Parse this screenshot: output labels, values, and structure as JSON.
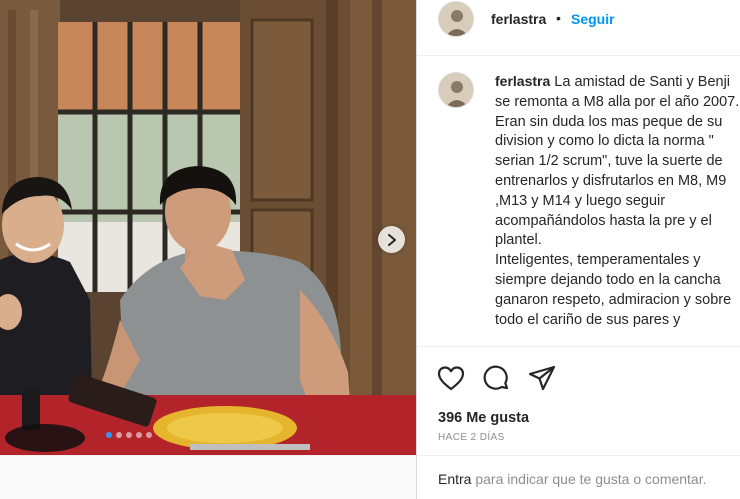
{
  "post": {
    "author": "ferlastra",
    "separator": "•",
    "follow_label": "Seguir",
    "caption": "La amistad de Santi y Benji\nse remonta a M8 alla por el año 2007.\nEran sin duda los mas peque de su\ndivision y como lo dicta la norma \"\nserian 1/2 scrum\", tuve la suerte de\nentrenarlos y disfrutarlos en M8, M9\n,M13 y M14 y luego seguir\nacompañándolos hasta la pre y el\nplantel.\nInteligentes, temperamentales y\nsiempre dejando todo en la cancha\nganaron respeto, admiracion y sobre\ntodo el cariño de sus pares y",
    "likes": "396 Me gusta",
    "time_ago": "HACE 2 DÍAS"
  },
  "add_comment": {
    "login_link": "Entra",
    "prompt": " para indicar que te gusta o comentar."
  },
  "carousel": {
    "slide_count": 5,
    "active_index": 0
  },
  "icons": {
    "like": "heart-icon",
    "comment": "comment-bubble-icon",
    "share": "paper-plane-icon",
    "next": "chevron-right-icon"
  },
  "colors": {
    "link_blue": "#0095f6",
    "text": "#262626",
    "muted": "#8e8e8e",
    "active_dot": "#3897f0"
  }
}
